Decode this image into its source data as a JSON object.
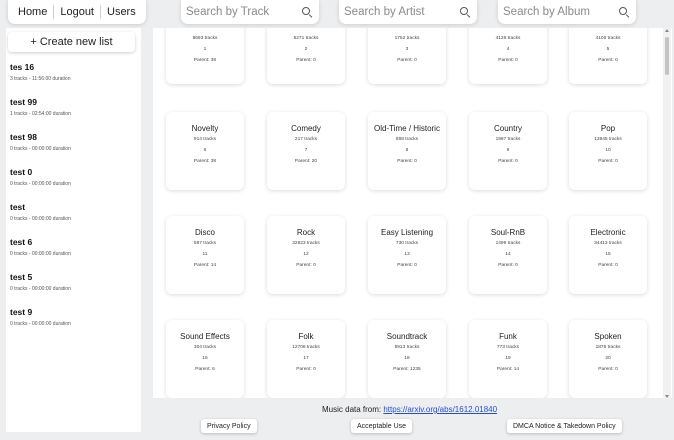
{
  "nav": {
    "home": "Home",
    "logout": "Logout",
    "users": "Users"
  },
  "search": {
    "track_placeholder": "Search by Track",
    "artist_placeholder": "Search by Artist",
    "album_placeholder": "Search by Album"
  },
  "sidebar": {
    "create_label": "+ Create new list",
    "playlists": [
      {
        "name": "tes 16",
        "meta": "3 tracks - 11:56:00 duration"
      },
      {
        "name": "test 99",
        "meta": "1 tracks - 02:54:00 duration"
      },
      {
        "name": "test 98",
        "meta": "0 tracks - 00:00:00 duration"
      },
      {
        "name": "test 0",
        "meta": "0 tracks - 00:00:00 duration"
      },
      {
        "name": "test",
        "meta": "0 tracks - 00:00:00 duration"
      },
      {
        "name": "test 6",
        "meta": "0 tracks - 00:00:00 duration"
      },
      {
        "name": "test 5",
        "meta": "0 tracks - 00:00:00 duration"
      },
      {
        "name": "test 9",
        "meta": "0 tracks - 00:00:00 duration"
      }
    ]
  },
  "genres": [
    {
      "tracks": "8693 tracks",
      "id": "1",
      "parent": "Parent: 38"
    },
    {
      "tracks": "5271 tracks",
      "id": "2",
      "parent": "Parent: 0"
    },
    {
      "tracks": "1752 tracks",
      "id": "3",
      "parent": "Parent: 0"
    },
    {
      "tracks": "4126 tracks",
      "id": "4",
      "parent": "Parent: 0"
    },
    {
      "tracks": "4106 tracks",
      "id": "5",
      "parent": "Parent: 0"
    },
    {
      "name": "Novelty",
      "tracks": "914 tracks",
      "id": "6",
      "parent": "Parent: 38"
    },
    {
      "name": "Comedy",
      "tracks": "217 tracks",
      "id": "7",
      "parent": "Parent: 20"
    },
    {
      "name": "Old-Time / Historic",
      "tracks": "868 tracks",
      "id": "8",
      "parent": "Parent: 0"
    },
    {
      "name": "Country",
      "tracks": "1987 tracks",
      "id": "9",
      "parent": "Parent: 0"
    },
    {
      "name": "Pop",
      "tracks": "13845 tracks",
      "id": "10",
      "parent": "Parent: 0"
    },
    {
      "name": "Disco",
      "tracks": "587 tracks",
      "id": "11",
      "parent": "Parent: 14"
    },
    {
      "name": "Rock",
      "tracks": "32923 tracks",
      "id": "12",
      "parent": "Parent: 0"
    },
    {
      "name": "Easy Listening",
      "tracks": "730 tracks",
      "id": "13",
      "parent": "Parent: 0"
    },
    {
      "name": "Soul-RnB",
      "tracks": "1499 tracks",
      "id": "14",
      "parent": "Parent: 0"
    },
    {
      "name": "Electronic",
      "tracks": "34413 tracks",
      "id": "15",
      "parent": "Parent: 0"
    },
    {
      "name": "Sound Effects",
      "tracks": "304 tracks",
      "id": "16",
      "parent": "Parent: 6"
    },
    {
      "name": "Folk",
      "tracks": "12706 tracks",
      "id": "17",
      "parent": "Parent: 0"
    },
    {
      "name": "Soundtrack",
      "tracks": "5913 tracks",
      "id": "18",
      "parent": "Parent: 1235"
    },
    {
      "name": "Funk",
      "tracks": "773 tracks",
      "id": "19",
      "parent": "Parent: 14"
    },
    {
      "name": "Spoken",
      "tracks": "1876 tracks",
      "id": "20",
      "parent": "Parent: 0"
    }
  ],
  "footer": {
    "music_data_prefix": "Music data from: ",
    "music_data_link": "https://arxiv.org/abs/1612.01840",
    "privacy": "Privacy Policy",
    "acceptable": "Acceptable Use",
    "dmca": "DMCA Notice & Takedown Policy"
  }
}
